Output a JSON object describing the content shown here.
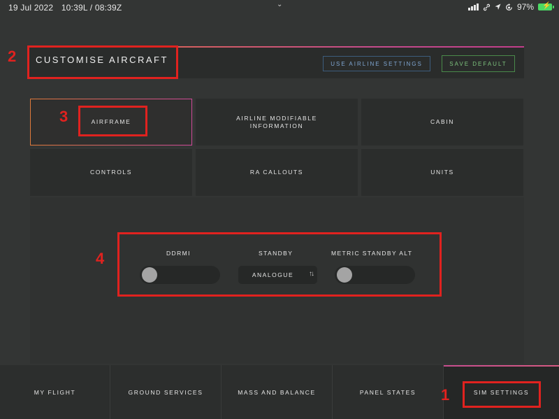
{
  "status_bar": {
    "date": "19 Jul 2022",
    "time": "10:39L / 08:39Z",
    "battery_percent": "97%"
  },
  "header": {
    "title": "CUSTOMISE AIRCRAFT",
    "use_airline_settings": "USE AIRLINE SETTINGS",
    "save_default": "SAVE DEFAULT"
  },
  "categories": [
    {
      "label": "AIRFRAME",
      "active": true
    },
    {
      "label": "AIRLINE MODIFIABLE\nINFORMATION",
      "active": false
    },
    {
      "label": "CABIN",
      "active": false
    },
    {
      "label": "CONTROLS",
      "active": false
    },
    {
      "label": "RA CALLOUTS",
      "active": false
    },
    {
      "label": "UNITS",
      "active": false
    }
  ],
  "settings": {
    "ddrmi": {
      "label": "DDRMI",
      "on": false
    },
    "standby": {
      "label": "STANDBY",
      "value": "ANALOGUE"
    },
    "metric_standby_alt": {
      "label": "METRIC STANDBY ALT",
      "on": false
    }
  },
  "bottom_nav": [
    {
      "label": "MY FLIGHT",
      "active": false
    },
    {
      "label": "GROUND SERVICES",
      "active": false
    },
    {
      "label": "MASS AND BALANCE",
      "active": false
    },
    {
      "label": "PANEL STATES",
      "active": false
    },
    {
      "label": "SIM SETTINGS",
      "active": true
    }
  ],
  "annotations": [
    "1",
    "2",
    "3",
    "4"
  ],
  "colors": {
    "background": "#333534",
    "annotation_red": "#e0221f",
    "accent_gradient_start": "#e0703a",
    "accent_gradient_end": "#c23e8b",
    "airline_button": "#7fa6d2",
    "save_button": "#7dc27d",
    "battery": "#4cd964"
  },
  "icons": [
    "chevron-down-icon",
    "signal-icon",
    "link-icon",
    "location-icon",
    "rotation-lock-icon",
    "battery-charging-icon",
    "sort-arrows-icon"
  ]
}
